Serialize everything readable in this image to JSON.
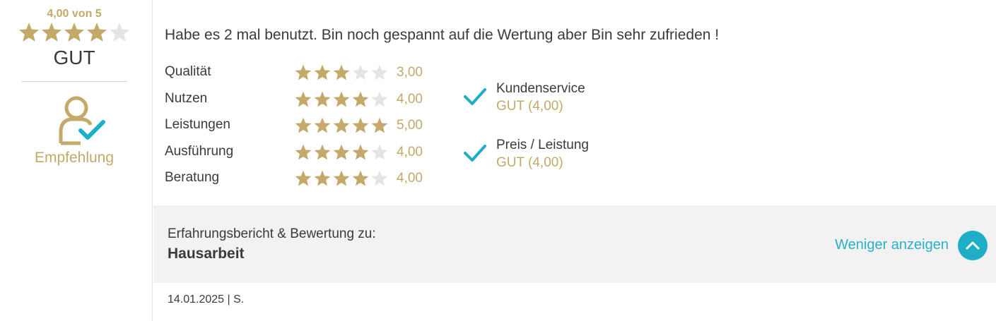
{
  "overall": {
    "score_text": "4,00 von 5",
    "stars": 4,
    "stars_max": 5,
    "label": "GUT",
    "recommendation_label": "Empfehlung"
  },
  "review": {
    "text": "Habe es 2 mal benutzt. Bin noch gespannt auf die Wertung aber Bin sehr zufrieden !"
  },
  "ratings": [
    {
      "label": "Qualität",
      "stars": 3,
      "value": "3,00"
    },
    {
      "label": "Nutzen",
      "stars": 4,
      "value": "4,00"
    },
    {
      "label": "Leistungen",
      "stars": 5,
      "value": "5,00"
    },
    {
      "label": "Ausführung",
      "stars": 4,
      "value": "4,00"
    },
    {
      "label": "Beratung",
      "stars": 4,
      "value": "4,00"
    }
  ],
  "features": [
    {
      "title": "Kundenservice",
      "value": "GUT (4,00)",
      "icon": "check-icon"
    },
    {
      "title": "Preis / Leistung",
      "value": "GUT (4,00)",
      "icon": "check-icon"
    }
  ],
  "experience": {
    "label": "Erfahrungsbericht & Bewertung zu:",
    "topic": "Hausarbeit",
    "less_link": "Weniger anzeigen",
    "collapse_icon": "chevron-up-icon"
  },
  "meta": {
    "date_author": "14.01.2025 | S."
  },
  "colors": {
    "gold": "#c3a96a",
    "star_empty": "#e4e4e4",
    "accent": "#1eaec5",
    "text": "#3a3a3a",
    "panel_bg": "#f2f2f3"
  }
}
